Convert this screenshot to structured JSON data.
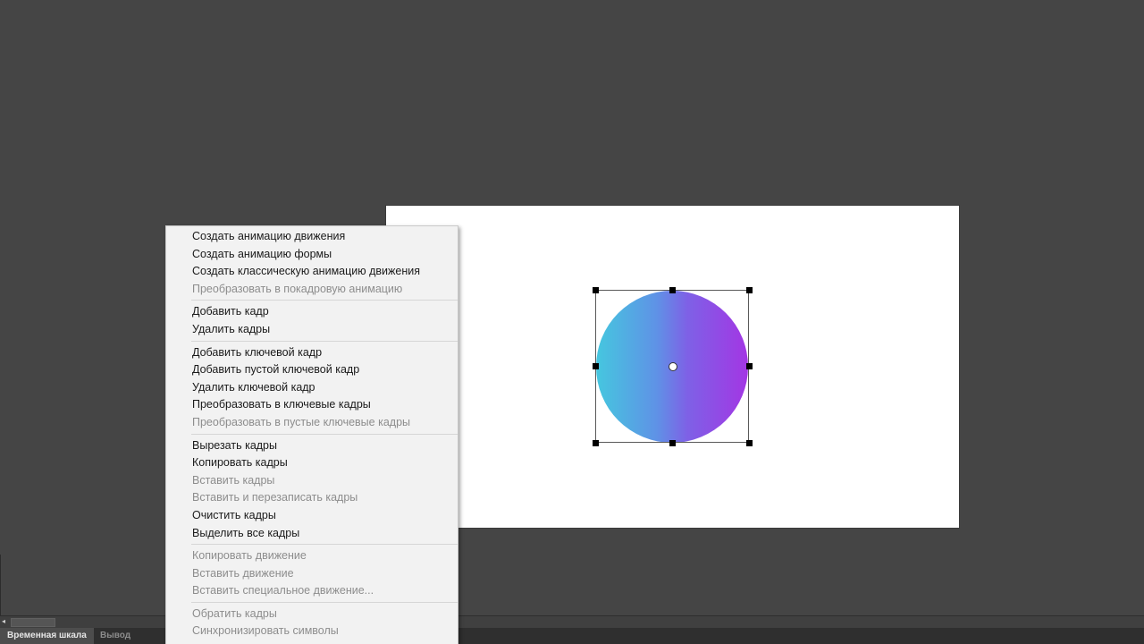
{
  "context_menu": {
    "items": [
      {
        "label": "Создать анимацию движения",
        "enabled": true
      },
      {
        "label": "Создать анимацию формы",
        "enabled": true
      },
      {
        "label": "Создать классическую анимацию движения",
        "enabled": true
      },
      {
        "label": "Преобразовать в покадровую анимацию",
        "enabled": false
      },
      {
        "separator": true
      },
      {
        "label": "Добавить кадр",
        "enabled": true
      },
      {
        "label": "Удалить кадры",
        "enabled": true
      },
      {
        "separator": true
      },
      {
        "label": "Добавить ключевой кадр",
        "enabled": true
      },
      {
        "label": "Добавить пустой ключевой кадр",
        "enabled": true
      },
      {
        "label": "Удалить ключевой кадр",
        "enabled": true
      },
      {
        "label": "Преобразовать в ключевые кадры",
        "enabled": true
      },
      {
        "label": "Преобразовать в пустые ключевые кадры",
        "enabled": false
      },
      {
        "separator": true
      },
      {
        "label": "Вырезать кадры",
        "enabled": true
      },
      {
        "label": "Копировать кадры",
        "enabled": true
      },
      {
        "label": "Вставить кадры",
        "enabled": false
      },
      {
        "label": "Вставить и перезаписать кадры",
        "enabled": false
      },
      {
        "label": "Очистить кадры",
        "enabled": true
      },
      {
        "label": "Выделить все кадры",
        "enabled": true
      },
      {
        "separator": true
      },
      {
        "label": "Копировать движение",
        "enabled": false
      },
      {
        "label": "Вставить движение",
        "enabled": false
      },
      {
        "label": "Вставить специальное движение...",
        "enabled": false
      },
      {
        "separator": true
      },
      {
        "label": "Обратить кадры",
        "enabled": false
      },
      {
        "label": "Синхронизировать символы",
        "enabled": false
      }
    ]
  },
  "tabs": {
    "timeline": "Временная шкала",
    "output": "Вывод"
  },
  "scrollbar": {
    "left_arrow": "◂"
  },
  "colors": {
    "workspace": "#454545",
    "stage": "#ffffff",
    "circle_gradient_start": "#45c7df",
    "circle_gradient_end": "#a336e4",
    "menu_bg": "#f2f2f2",
    "menu_text": "#1a1a1a",
    "menu_text_disabled": "#8d8d8d"
  }
}
